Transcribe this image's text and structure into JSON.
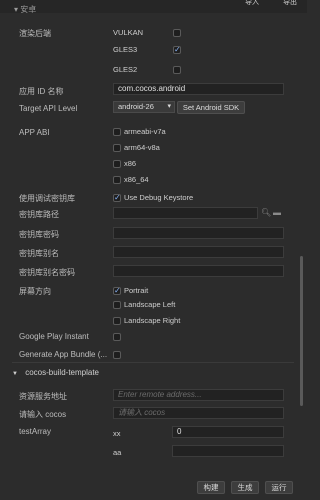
{
  "header": {
    "section_title": "安卓",
    "import_label": "导入",
    "export_label": "导出"
  },
  "renderer": {
    "label": "渲染后端",
    "options": [
      {
        "label": "VULKAN",
        "checked": false
      },
      {
        "label": "GLES3",
        "checked": true
      },
      {
        "label": "GLES2",
        "checked": false
      }
    ]
  },
  "app_id": {
    "label": "应用 ID 名称",
    "value": "com.cocos.android"
  },
  "target_api": {
    "label": "Target API Level",
    "selected": "android-26",
    "sdk_button": "Set Android SDK"
  },
  "app_abi": {
    "label": "APP ABI",
    "options": [
      {
        "label": "armeabi-v7a",
        "checked": false
      },
      {
        "label": "arm64-v8a",
        "checked": false
      },
      {
        "label": "x86",
        "checked": false
      },
      {
        "label": "x86_64",
        "checked": false
      }
    ]
  },
  "debug_keystore": {
    "label": "使用调试密钥库",
    "option": "Use Debug Keystore",
    "checked": true
  },
  "keystore_path": {
    "label": "密钥库路径"
  },
  "keystore_password": {
    "label": "密钥库密码"
  },
  "keystore_alias": {
    "label": "密钥库别名"
  },
  "keystore_alias_password": {
    "label": "密钥库别名密码"
  },
  "orientation": {
    "label": "屏幕方向",
    "options": [
      {
        "label": "Portrait",
        "checked": true
      },
      {
        "label": "Landscape Left",
        "checked": false
      },
      {
        "label": "Landscape Right",
        "checked": false
      }
    ]
  },
  "google_play_instant": {
    "label": "Google Play Instant",
    "checked": false
  },
  "app_bundle": {
    "label": "Generate App Bundle (...",
    "checked": false
  },
  "template_section": {
    "title": "cocos-build-template"
  },
  "remote_server": {
    "label": "资源服务地址",
    "placeholder": "Enter remote address..."
  },
  "cocos_input": {
    "label": "请输入 cocos",
    "placeholder": "请输入 cocos"
  },
  "test_array": {
    "label": "testArray",
    "items": [
      {
        "key": "xx",
        "value": "0"
      },
      {
        "key": "aa",
        "value": ""
      }
    ]
  },
  "footer": {
    "build": "构建",
    "make": "生成",
    "run": "运行"
  }
}
